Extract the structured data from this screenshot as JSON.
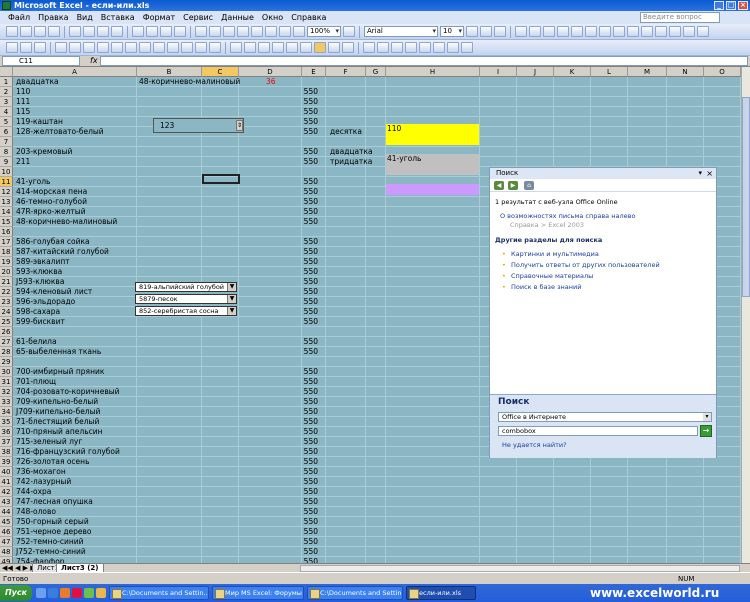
{
  "window": {
    "title": "Microsoft Excel - если-или.xls"
  },
  "menu": [
    "Файл",
    "Правка",
    "Вид",
    "Вставка",
    "Формат",
    "Сервис",
    "Данные",
    "Окно",
    "Справка"
  ],
  "help_box_placeholder": "Введите вопрос",
  "toolbar": {
    "zoom": "100%",
    "font": "Arial",
    "font_size": "10"
  },
  "formula_bar": {
    "name_box": "C11",
    "fx": "fx",
    "value": ""
  },
  "columns": [
    "A",
    "B",
    "C",
    "D",
    "E",
    "F",
    "G",
    "H",
    "I",
    "J",
    "K",
    "L",
    "M",
    "N",
    "O"
  ],
  "rows": [
    "1",
    "2",
    "3",
    "4",
    "5",
    "6",
    "7",
    "8",
    "9",
    "10",
    "11",
    "12",
    "13",
    "14",
    "15",
    "16",
    "17",
    "18",
    "19",
    "20",
    "21",
    "22",
    "23",
    "24",
    "25",
    "26",
    "27",
    "28",
    "29",
    "30",
    "31",
    "32",
    "33",
    "34",
    "35",
    "36",
    "37",
    "38",
    "39",
    "40",
    "41",
    "42",
    "43",
    "44",
    "45",
    "46",
    "47",
    "48",
    "49"
  ],
  "colA": [
    "двадцатка",
    "110",
    "111",
    "115",
    "119-каштан",
    "128-желтовато-белый",
    "",
    "203-кремовый",
    "211",
    "",
    "41-уголь",
    "414-морская пена",
    "46-темно-голубой",
    "47R-ярко-желтый",
    "48-коричнево-малиновый",
    "",
    "586-голубая сойка",
    "587-китайский голубой",
    "589-эвкалипт",
    "593-клюква",
    "J593-клюква",
    "594-кленовый лист",
    "596-эльдорадо",
    "598-сахара",
    "599-бисквит",
    "",
    "61-белила",
    "65-выбеленная ткань",
    "",
    "700-имбирный пряник",
    "701-плющ",
    "704-розовато-коричневый",
    "709-кипельно-белый",
    "J709-кипельно-белый",
    "71-блестящий белый",
    "710-пряный апельсин",
    "715-зеленый луг",
    "716-французский голубой",
    "726-золотая осень",
    "736-мохагон",
    "742-лазурный",
    "744-охра",
    "747-лесная опушка",
    "748-олово",
    "750-горный серый",
    "751-черное дерево",
    "752-темно-синий",
    "J752-темно-синий",
    "754-фарфор"
  ],
  "colE": [
    "",
    "550",
    "550",
    "550",
    "550",
    "550",
    "",
    "550",
    "550",
    "",
    "550",
    "550",
    "550",
    "550",
    "550",
    "",
    "550",
    "550",
    "550",
    "550",
    "550",
    "550",
    "550",
    "550",
    "550",
    "",
    "550",
    "550",
    "",
    "550",
    "550",
    "550",
    "550",
    "550",
    "550",
    "550",
    "550",
    "550",
    "550",
    "550",
    "550",
    "550",
    "550",
    "550",
    "550",
    "550",
    "550",
    "550",
    "550"
  ],
  "cells": {
    "b1": "48-коричнево-малиновый",
    "d1": "36",
    "f6": "десятка",
    "h6": "110",
    "f8": "двадцатка",
    "f9": "тридцатка",
    "h9": "41-уголь"
  },
  "spinbox_value": "123",
  "combos": [
    "819-альпийский голубой",
    "5879-песок",
    "852-серебристая сосна"
  ],
  "sheet_tabs": [
    "Лист1",
    "Лист3 (2)"
  ],
  "status": {
    "ready": "Готово",
    "num": "NUM"
  },
  "task_pane": {
    "title": "Поиск",
    "result_count": "1 результат с веб-узла Office Online",
    "result_link": "О возможностях письма справа налево",
    "result_sub": "Справка > Excel 2003",
    "other_heading": "Другие разделы для поиска",
    "other_links": [
      "Картинки и мультимедиа",
      "Получить ответы от других пользователей",
      "Справочные материалы",
      "Поиск в базе знаний"
    ],
    "search_title": "Поиск",
    "scope": "Office в Интернете",
    "query": "combobox",
    "help_link": "Не удается найти?"
  },
  "taskbar": {
    "start": "Пуск",
    "tasks": [
      "C:\\Documents and Settin...",
      "Мир MS Excel: Форумы ...",
      "C:\\Documents and Settin...",
      "если-или.xls"
    ]
  },
  "watermark": "www.excelworld.ru",
  "colors": {
    "grid_bg": "#8bb7c5",
    "highlight_yellow": "#ffff00",
    "highlight_gray": "#c0c0c0",
    "highlight_purple": "#cc99ff",
    "accent_red": "#e00000"
  }
}
